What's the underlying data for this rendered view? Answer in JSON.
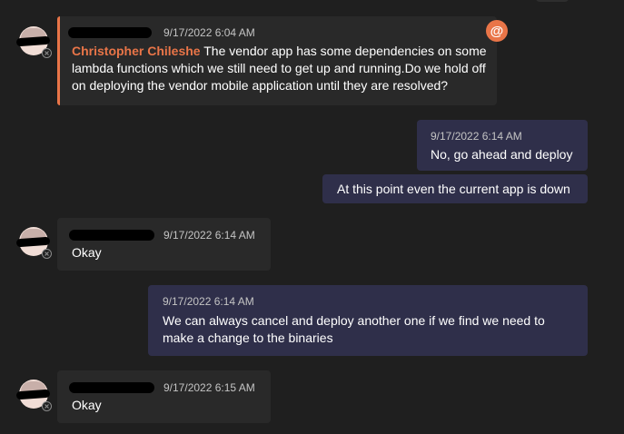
{
  "messages": [
    {
      "direction": "incoming",
      "timestamp": "9/17/2022 6:04 AM",
      "sender_mention": "Christopher Chileshe",
      "text": " The vendor app has some dependencies on some lambda functions which we still need to get up and running.Do we hold off on deploying the vendor mobile application until they are resolved?",
      "mention_icon": "@"
    },
    {
      "direction": "outgoing",
      "timestamp": "9/17/2022 6:14 AM",
      "text": "No, go ahead and deploy"
    },
    {
      "direction": "outgoing",
      "text": "At this point even the current app is down"
    },
    {
      "direction": "incoming",
      "timestamp": "9/17/2022 6:14 AM",
      "text": "Okay"
    },
    {
      "direction": "outgoing",
      "timestamp": "9/17/2022 6:14 AM",
      "text": "We can always cancel and deploy another one if we find we need to make a change to the binaries"
    },
    {
      "direction": "incoming",
      "timestamp": "9/17/2022 6:15 AM",
      "text": "Okay"
    }
  ],
  "colors": {
    "background": "#1f1f1f",
    "incoming_bubble": "#292929",
    "outgoing_bubble": "#2f2f4a",
    "mention_accent": "#e97548",
    "timestamp": "#c4c4c4"
  },
  "icons": {
    "avatar": "user-avatar-redacted",
    "presence": "offline-presence-icon",
    "mention": "at-mention-icon"
  }
}
